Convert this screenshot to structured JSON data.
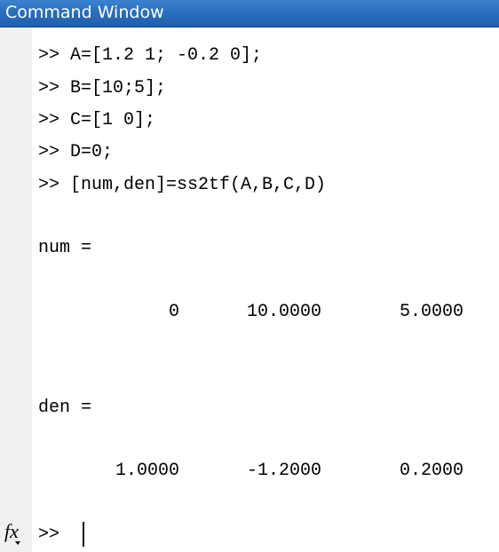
{
  "window": {
    "title": "Command Window"
  },
  "history": [
    ">> A=[1.2 1; -0.2 0];",
    ">> B=[10;5];",
    ">> C=[1 0];",
    ">> D=0;",
    ">> [num,den]=ss2tf(A,B,C,D)"
  ],
  "output": {
    "num_label": "num =",
    "num_values": [
      "0",
      "10.0000",
      "5.0000"
    ],
    "den_label": "den =",
    "den_values": [
      "1.0000",
      "-1.2000",
      "0.2000"
    ]
  },
  "prompt": {
    "fx_icon": "fx-function-browser-icon",
    "fx_label": "fx",
    "symbol": ">>"
  },
  "colors": {
    "titlebar": "#2a6fbe",
    "gutter": "#f0f0f0",
    "text": "#000000"
  }
}
